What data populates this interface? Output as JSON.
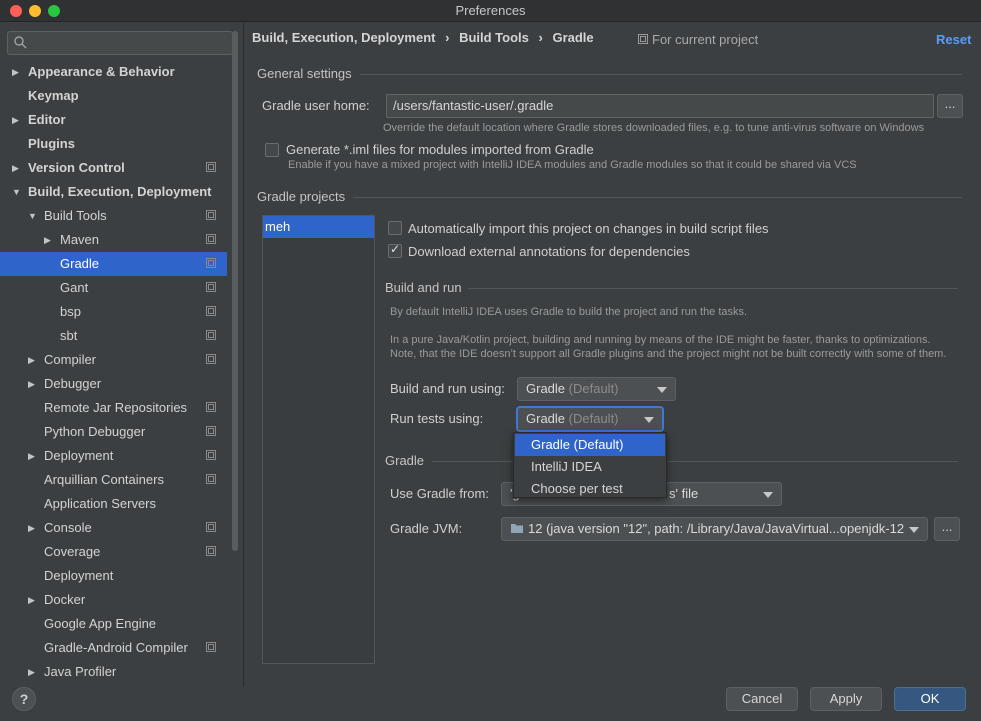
{
  "window": {
    "title": "Preferences"
  },
  "search": {
    "placeholder": ""
  },
  "sidebar": {
    "items": [
      {
        "label": "Appearance & Behavior",
        "arrow": "▶",
        "bold": true
      },
      {
        "label": "Keymap",
        "bold": true
      },
      {
        "label": "Editor",
        "arrow": "▶",
        "bold": true
      },
      {
        "label": "Plugins",
        "bold": true
      },
      {
        "label": "Version Control",
        "arrow": "▶",
        "bold": true,
        "project": true
      },
      {
        "label": "Build, Execution, Deployment",
        "arrow": "▼",
        "bold": true
      },
      {
        "label": "Build Tools",
        "arrow": "▼",
        "project": true
      },
      {
        "label": "Maven",
        "arrow": "▶",
        "project": true
      },
      {
        "label": "Gradle",
        "selected": true,
        "project": true
      },
      {
        "label": "Gant",
        "project": true
      },
      {
        "label": "bsp",
        "project": true
      },
      {
        "label": "sbt",
        "project": true
      },
      {
        "label": "Compiler",
        "arrow": "▶",
        "project": true
      },
      {
        "label": "Debugger",
        "arrow": "▶"
      },
      {
        "label": "Remote Jar Repositories",
        "project": true
      },
      {
        "label": "Python Debugger",
        "project": true
      },
      {
        "label": "Deployment",
        "arrow": "▶",
        "project": true
      },
      {
        "label": "Arquillian Containers",
        "project": true
      },
      {
        "label": "Application Servers"
      },
      {
        "label": "Console",
        "arrow": "▶",
        "project": true
      },
      {
        "label": "Coverage",
        "project": true
      },
      {
        "label": "Deployment"
      },
      {
        "label": "Docker",
        "arrow": "▶"
      },
      {
        "label": "Google App Engine"
      },
      {
        "label": "Gradle-Android Compiler",
        "project": true
      },
      {
        "label": "Java Profiler",
        "arrow": "▶"
      }
    ]
  },
  "header": {
    "breadcrumb": [
      "Build, Execution, Deployment",
      "›",
      "Build Tools",
      "›",
      "Gradle"
    ],
    "for_project": "For current project",
    "reset": "Reset"
  },
  "general": {
    "title": "General settings",
    "user_home_label": "Gradle user home:",
    "user_home_value": "/users/fantastic-user/.gradle",
    "browse": "...",
    "user_home_hint": "Override the default location where Gradle stores downloaded files, e.g. to tune anti-virus software on Windows",
    "iml_label": "Generate *.iml files for modules imported from Gradle",
    "iml_hint": "Enable if you have a mixed project with IntelliJ IDEA modules and Gradle modules so that it could be shared via VCS"
  },
  "projects": {
    "title": "Gradle projects",
    "list": [
      "meh"
    ],
    "auto_import_label": "Automatically import this project on changes in build script files",
    "download_annotations_label": "Download external annotations for dependencies"
  },
  "build_run": {
    "title": "Build and run",
    "hint1": "By default IntelliJ IDEA uses Gradle to build the project and run the tasks.",
    "hint2": "In a pure Java/Kotlin project, building and running by means of the IDE might be faster, thanks to optimizations.",
    "hint3": "Note, that the IDE doesn’t support all Gradle plugins and the project might not be built correctly with some of them.",
    "build_using_label": "Build and run using:",
    "build_using_value": "Gradle",
    "build_using_suffix": "(Default)",
    "tests_using_label": "Run tests using:",
    "tests_using_value": "Gradle",
    "tests_using_suffix": "(Default)",
    "options": [
      "Gradle (Default)",
      "IntelliJ IDEA",
      "Choose per test"
    ]
  },
  "gradle": {
    "title": "Gradle",
    "use_from_label": "Use Gradle from:",
    "use_from_value_start": "'g",
    "use_from_value_end": "s' file",
    "jvm_label": "Gradle JVM:",
    "jvm_value": "12 (java version \"12\", path: /Library/Java/JavaVirtual...openjdk-12",
    "browse": "..."
  },
  "footer": {
    "help": "?",
    "cancel": "Cancel",
    "apply": "Apply",
    "ok": "OK"
  }
}
